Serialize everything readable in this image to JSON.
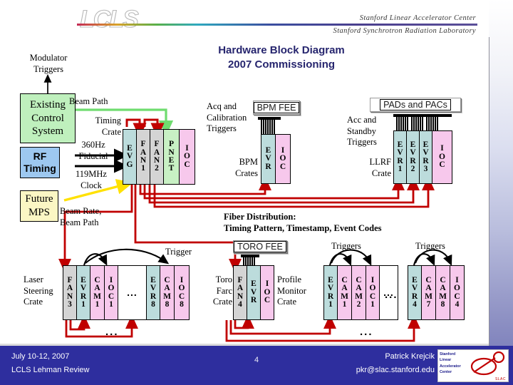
{
  "header": {
    "logo_text": "LCLS",
    "line1": "Stanford Linear Accelerator Center",
    "line2": "Stanford Synchrotron Radiation Laboratory"
  },
  "title": {
    "line1": "Hardware Block Diagram",
    "line2": "2007 Commissioning"
  },
  "labels": {
    "modulator_triggers": "Modulator\nTriggers",
    "beam_path": "Beam Path",
    "timing_crate": "Timing\nCrate",
    "fiducial_360": "360Hz\nFiducial",
    "clock_119": "119MHz\nClock",
    "beam_rate_path": "Beam Rate,\nBeam Path",
    "acq_cal_triggers": "Acq and\nCalibration\nTriggers",
    "bpm_crates": "BPM\nCrates",
    "acc_standby_triggers": "Acc and\nStandby\nTriggers",
    "llrf_crate": "LLRF\nCrate",
    "fiber_distribution_1": "Fiber Distribution:",
    "fiber_distribution_2": "Timing Pattern, Timestamp, Event Codes",
    "trigger": "Trigger",
    "triggers_a": "Triggers",
    "triggers_b": "Triggers",
    "laser_steering_crate": "Laser\nSteering\nCrate",
    "toro_farc_crate": "Toro\nFarc\nCrate",
    "profile_monitor_crate": "Profile\nMonitor\nCrate",
    "ellipsis": "..."
  },
  "system_boxes": [
    {
      "id": "existing-control-system",
      "label": "Existing\nControl\nSystem",
      "color": "#bff0bd",
      "style": "serif"
    },
    {
      "id": "rf-timing",
      "label": "RF\nTiming",
      "color": "#9dc8f0",
      "style": "sans"
    },
    {
      "id": "future-mps",
      "label": "Future\nMPS",
      "color": "#fbf7c4",
      "style": "serif"
    }
  ],
  "fee_labels": [
    {
      "id": "bpm-fee",
      "text": "BPM FEE"
    },
    {
      "id": "pads-and-pacs",
      "text": "PADs and PACs"
    },
    {
      "id": "toro-fee",
      "text": "TORO FEE"
    }
  ],
  "crates": {
    "timing": {
      "name": "Timing Crate",
      "modules": [
        {
          "text": "EVG",
          "kind": "evg"
        },
        {
          "text": "FAN1",
          "kind": "fan"
        },
        {
          "text": "FAN2",
          "kind": "fan"
        },
        {
          "text": "PNET",
          "kind": "pnet"
        },
        {
          "text": "IOC",
          "kind": "ioc"
        }
      ]
    },
    "bpm": {
      "name": "BPM Crates",
      "modules": [
        {
          "text": "EVR",
          "kind": "evr"
        },
        {
          "text": "IOC",
          "kind": "ioc"
        }
      ]
    },
    "llrf": {
      "name": "LLRF Crate",
      "modules": [
        {
          "text": "EVR1",
          "kind": "evr"
        },
        {
          "text": "EVR2",
          "kind": "evr"
        },
        {
          "text": "EVR3",
          "kind": "evr"
        },
        {
          "text": "IOC",
          "kind": "ioc"
        }
      ]
    },
    "laser_steering": {
      "name": "Laser Steering Crate",
      "modules": [
        {
          "text": "FAN3",
          "kind": "fan"
        },
        {
          "text": "EVR1",
          "kind": "evr"
        },
        {
          "text": "CAM1",
          "kind": "cam"
        },
        {
          "text": "IOC1",
          "kind": "ioc"
        },
        {
          "text": "...",
          "kind": "dots"
        },
        {
          "text": "EVR8",
          "kind": "evr"
        },
        {
          "text": "CAM8",
          "kind": "cam"
        },
        {
          "text": "IOC8",
          "kind": "ioc"
        }
      ]
    },
    "toro_farc": {
      "name": "Toro Farc Crate",
      "modules": [
        {
          "text": "FAN4",
          "kind": "fan"
        },
        {
          "text": "EVR",
          "kind": "evr"
        },
        {
          "text": "IOC",
          "kind": "ioc"
        }
      ]
    },
    "profile_monitor": {
      "name": "Profile Monitor Crate",
      "modules": [
        {
          "text": "EVR1",
          "kind": "evr"
        },
        {
          "text": "CAM1",
          "kind": "cam"
        },
        {
          "text": "CAM2",
          "kind": "cam"
        },
        {
          "text": "IOC1",
          "kind": "ioc"
        },
        {
          "text": "...",
          "kind": "dots"
        }
      ]
    },
    "profile_monitor_last": {
      "name": "Profile Monitor Crate (last)",
      "modules": [
        {
          "text": "EVR4",
          "kind": "evr"
        },
        {
          "text": "CAM7",
          "kind": "cam"
        },
        {
          "text": "CAM8",
          "kind": "cam"
        },
        {
          "text": "IOC4",
          "kind": "ioc"
        }
      ]
    }
  },
  "colors": {
    "title": "#26256e",
    "fiber_red": "#c00000",
    "beam_green": "#6fdc6f",
    "mps_yellow": "#ffe100",
    "evr_fill": "#bcdcdc",
    "fan_fill": "#d4d4d4",
    "pnet_fill": "#c8f0c4",
    "ioc_fill": "#f7c8ec",
    "footer_bg": "#2e2e9e"
  },
  "footer": {
    "date": "July 10-12, 2007",
    "event": "LCLS Lehman Review",
    "page": "4",
    "author": "Patrick Krejcik",
    "email": "pkr@slac.stanford.edu",
    "logo_lines": [
      "Stanford",
      "Linear",
      "Accelerator",
      "Center"
    ],
    "logo_tag": "SLAC"
  }
}
